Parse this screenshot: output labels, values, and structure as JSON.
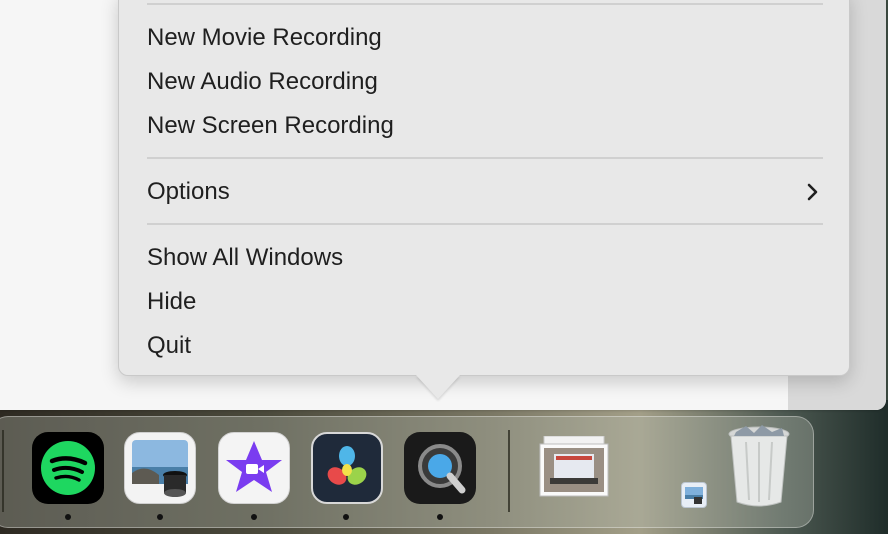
{
  "menu": {
    "items": [
      {
        "label": "New Movie Recording"
      },
      {
        "label": "New Audio Recording"
      },
      {
        "label": "New Screen Recording"
      },
      {
        "label": "Options",
        "submenu": true
      },
      {
        "label": "Show All Windows"
      },
      {
        "label": "Hide"
      },
      {
        "label": "Quit"
      }
    ]
  },
  "dock": {
    "apps": [
      {
        "name": "Spotify",
        "icon": "spotify-icon",
        "running": true
      },
      {
        "name": "Preview",
        "icon": "preview-icon",
        "running": true
      },
      {
        "name": "iMovie",
        "icon": "imovie-icon",
        "running": true
      },
      {
        "name": "DaVinci Resolve",
        "icon": "davinci-resolve-icon",
        "running": true
      },
      {
        "name": "QuickTime Player",
        "icon": "quicktime-icon",
        "running": true
      }
    ],
    "stack_icon": "downloads-stack-icon",
    "minimized_icon": "minimized-window-icon",
    "trash_icon": "trash-full-icon"
  },
  "colors": {
    "menu_bg": "#e8e8e8",
    "menu_text": "#1f1f1f",
    "separator": "#d0d0d0",
    "spotify_green": "#1ed760",
    "imovie_purple": "#7a3cf0"
  }
}
